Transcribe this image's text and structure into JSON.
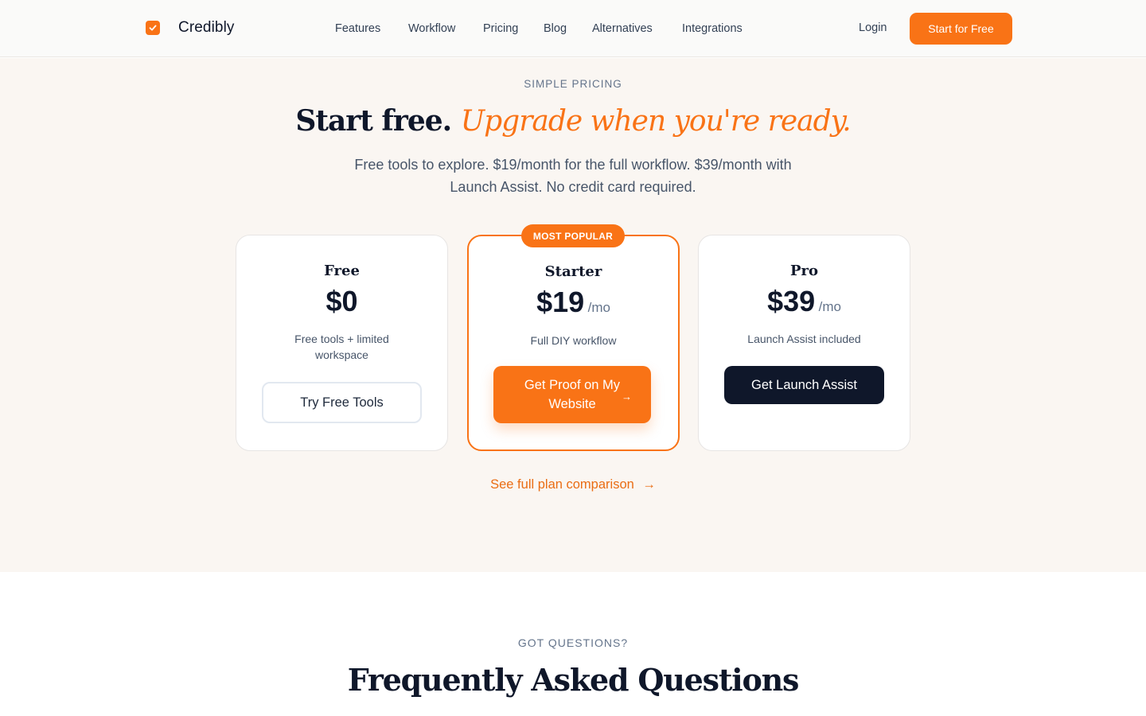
{
  "header": {
    "brand": "Credibly",
    "nav": [
      {
        "label": "Features"
      },
      {
        "label": "Workflow"
      },
      {
        "label": "Pricing"
      },
      {
        "label": "Blog"
      },
      {
        "label": "Alternatives"
      },
      {
        "label": "Integrations"
      }
    ],
    "login": "Login",
    "cta": "Start for Free"
  },
  "pricing": {
    "eyebrow": "SIMPLE PRICING",
    "headline_plain": "Start free.",
    "headline_accent": "Upgrade when you're ready.",
    "subtitle": "Free tools to explore. $19/month for the full workflow. $39/month with Launch Assist. No credit card required.",
    "badge": "MOST POPULAR",
    "plans": [
      {
        "name": "Free",
        "price": "$0",
        "per": "",
        "desc": "Free tools + limited workspace",
        "button": "Try Free Tools"
      },
      {
        "name": "Starter",
        "price": "$19",
        "per": "/mo",
        "desc": "Full DIY workflow",
        "button": "Get Proof on My Website"
      },
      {
        "name": "Pro",
        "price": "$39",
        "per": "/mo",
        "desc": "Launch Assist included",
        "button": "Get Launch Assist"
      }
    ],
    "compare_link": "See full plan comparison",
    "arrow": "→"
  },
  "faq": {
    "eyebrow": "GOT QUESTIONS?",
    "title": "Frequently Asked Questions"
  },
  "colors": {
    "accent": "#f97316",
    "dark": "#0f172a"
  }
}
